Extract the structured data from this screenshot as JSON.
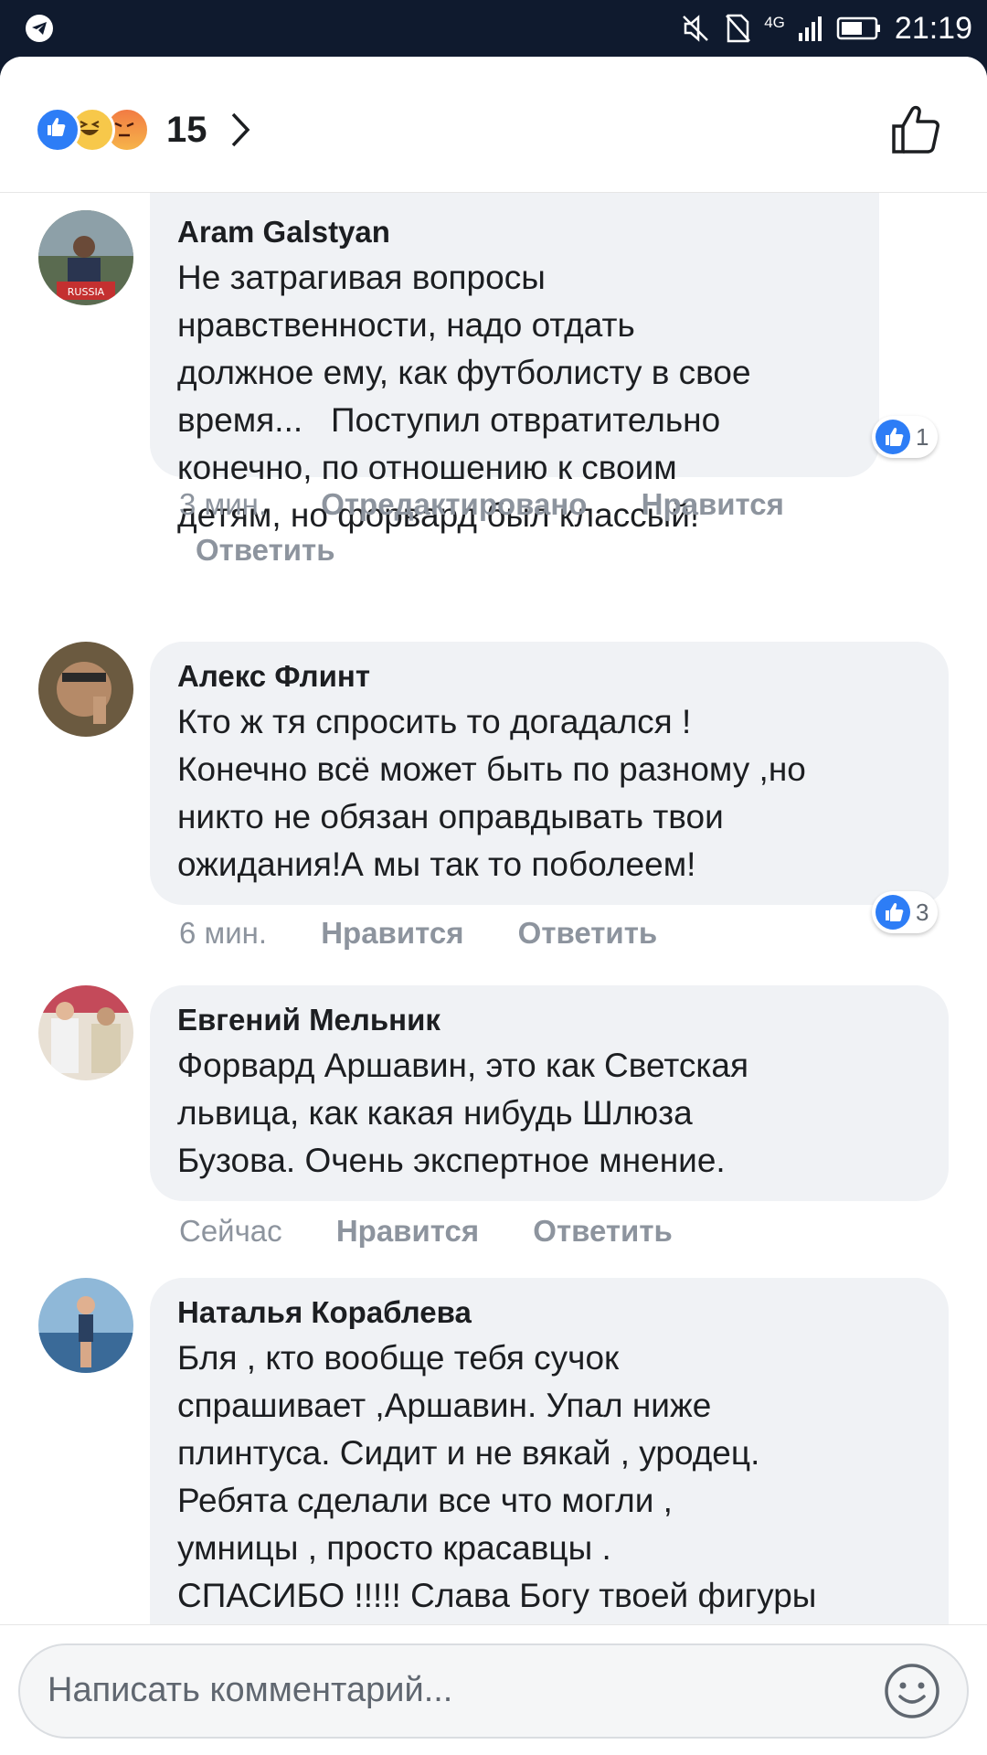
{
  "status_bar": {
    "time": "21:19",
    "network": "4G",
    "icons": [
      "telegram-icon",
      "mute-icon",
      "no-sim-icon",
      "signal-icon",
      "battery-icon"
    ]
  },
  "header": {
    "reaction_icons": [
      "like-reaction-icon",
      "haha-reaction-icon",
      "angry-reaction-icon"
    ],
    "reaction_count": "15",
    "like_button_icon": "thumbs-up-outline-icon"
  },
  "comments": [
    {
      "author": "Aram Galstyan",
      "text": "Не затрагивая вопросы\nнравственности, надо отдать\nдолжное ему, как футболисту в свое\nвремя...   Поступил отвратительно\nконечно, по отношению к своим\nдетям, но форвард был классый!",
      "time": "3 мин.",
      "edited": "Отредактировано",
      "like_label": "Нравится",
      "reply_label": "Ответить",
      "likes": "1"
    },
    {
      "author": "Алекс Флинт",
      "text": "Кто ж тя спросить то догадался !\nКонечно всё может быть по разному ,но\nникто не обязан оправдывать твои\nожидания!А мы так то поболеем!",
      "time": "6 мин.",
      "like_label": "Нравится",
      "reply_label": "Ответить",
      "likes": "3"
    },
    {
      "author": "Евгений Мельник",
      "text": "Форвард Аршавин, это как Светская\nльвица, как какая нибудь Шлюза\nБузова. Очень экспертное мнение.",
      "time": "Сейчас",
      "like_label": "Нравится",
      "reply_label": "Ответить"
    },
    {
      "author": "Наталья Кораблева",
      "text": "Бля , кто вообще тебя сучок\nспрашивает ,Аршавин. Упал ниже\nплинтуса. Сидит и не вякай , уродец.\nРебята сделали все что могли ,\nумницы , просто красавцы .\nСПАСИБО !!!!! Слава Богу твоей фигуры"
    }
  ],
  "composer": {
    "placeholder": "Написать комментарий...",
    "emoji_icon": "smiley-icon"
  },
  "colors": {
    "status_bar": "#0f1a2e",
    "bubble": "#f0f2f5",
    "like_blue": "#2d7df6",
    "meta_text": "#8d949e"
  }
}
